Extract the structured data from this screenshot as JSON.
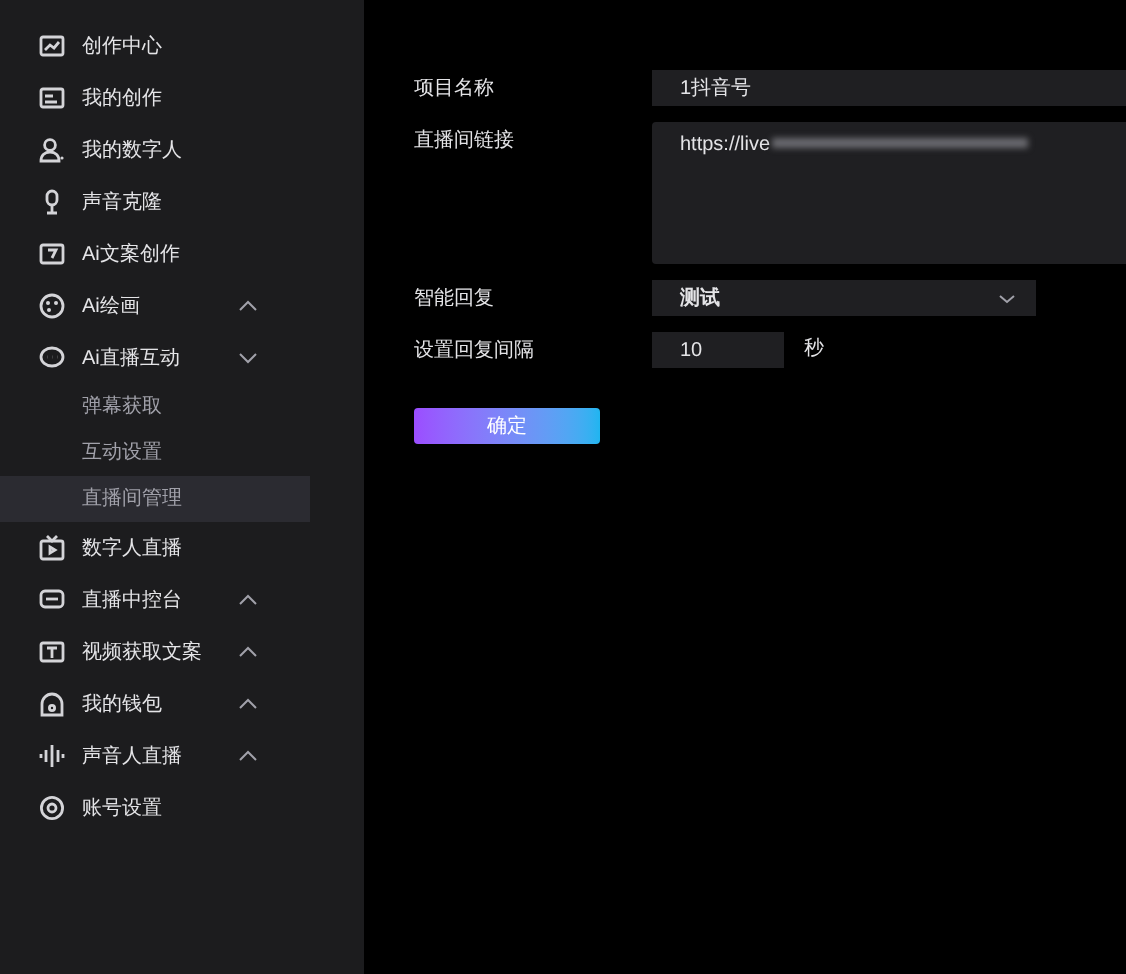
{
  "sidebar": {
    "items": [
      {
        "label": "创作中心"
      },
      {
        "label": "我的创作"
      },
      {
        "label": "我的数字人"
      },
      {
        "label": "声音克隆"
      },
      {
        "label": "Ai文案创作"
      },
      {
        "label": "Ai绘画",
        "expanded": false
      },
      {
        "label": "Ai直播互动",
        "expanded": true,
        "children": [
          {
            "label": "弹幕获取",
            "selected": false
          },
          {
            "label": "互动设置",
            "selected": false
          },
          {
            "label": "直播间管理",
            "selected": true
          }
        ]
      },
      {
        "label": "数字人直播"
      },
      {
        "label": "直播中控台",
        "expanded": false
      },
      {
        "label": "视频获取文案",
        "expanded": false
      },
      {
        "label": "我的钱包",
        "expanded": false
      },
      {
        "label": "声音人直播",
        "expanded": false
      },
      {
        "label": "账号设置"
      }
    ]
  },
  "form": {
    "fields": [
      {
        "kind": "text",
        "label": "项目名称",
        "value": "1抖音号"
      },
      {
        "kind": "textarea",
        "label": "直播间链接",
        "value": "https://live"
      },
      {
        "kind": "select",
        "label": "智能回复",
        "value": "测试"
      },
      {
        "kind": "number",
        "label": "设置回复间隔",
        "value": "10",
        "unit": "秒"
      }
    ],
    "submit": "确定"
  }
}
